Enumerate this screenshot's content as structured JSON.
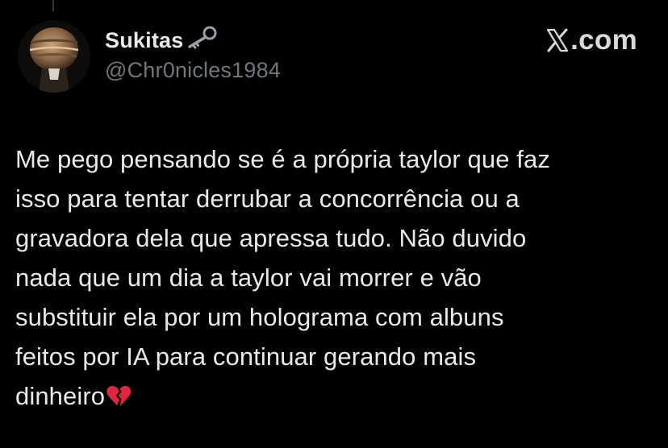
{
  "tweet": {
    "author": {
      "display_name": "Sukitas",
      "name_badge_icon": "key-icon",
      "handle": "@Chr0nicles1984",
      "avatar_icon": "avatar-image"
    },
    "brand": {
      "logo_icon": "x-logo-icon",
      "text": ".com"
    },
    "text": "Me pego pensando se é a própria taylor que faz\nisso para tentar derrubar a concorrência ou a\ngravadora dela que apressa tudo. Não duvido\nnada que um dia a taylor vai morrer e vão\nsubstituir ela por um holograma com albuns\nfeitos por IA para continuar gerando mais\ndinheiro",
    "trailing_emoji_icon": "broken-heart-icon"
  },
  "colors": {
    "background": "#000000",
    "primary_text": "#e7e9ea",
    "secondary_text": "#71767b",
    "emoji_red": "#e2263f"
  }
}
